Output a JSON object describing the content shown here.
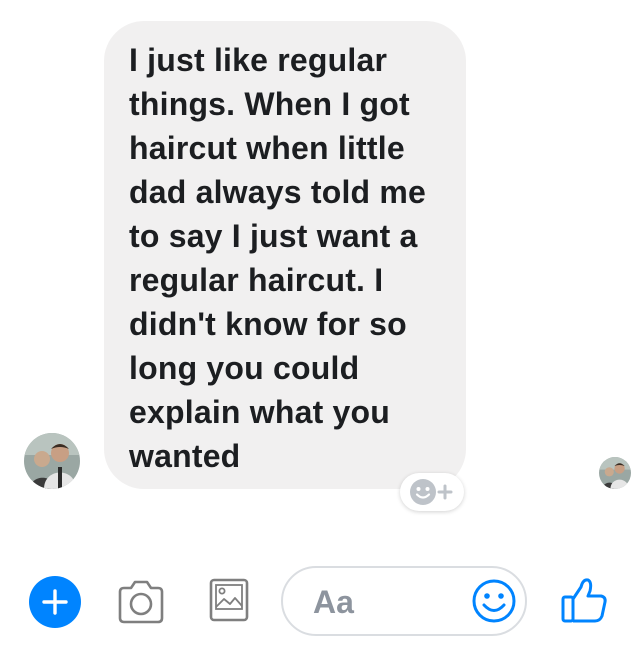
{
  "conversation": {
    "message": {
      "text": "I just like regular things. When I got haircut when little dad always told me to say I just want a regular haircut. I didn't know for so long you could explain what you wanted",
      "bubble_color": "#f1f0f0"
    },
    "sender_avatar_icon": "profile-photo",
    "reaction_icon": "add-reaction-icon",
    "read_receipt_icon": "profile-photo"
  },
  "composer": {
    "input_placeholder": "Aa",
    "accent_color": "#0084ff",
    "icons": [
      "plus-icon",
      "camera-icon",
      "photo-gallery-icon",
      "emoji-icon",
      "thumbs-up-icon"
    ]
  }
}
